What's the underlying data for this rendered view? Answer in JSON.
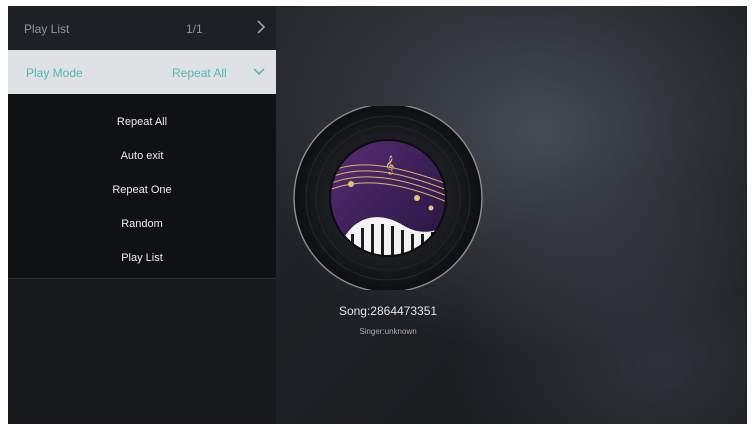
{
  "playlist_row": {
    "label": "Play List",
    "value": "1/1",
    "chevron_icon": "chevron-right-icon"
  },
  "playmode_row": {
    "label": "Play Mode",
    "value": "Repeat All",
    "chevron_icon": "chevron-down-icon"
  },
  "playmode_options": [
    "Repeat All",
    "Auto exit",
    "Repeat One",
    "Random",
    "Play List"
  ],
  "now_playing": {
    "song": "Song:2864473351",
    "singer": "Singer:unknown"
  },
  "colors": {
    "accent": "#58b6b0",
    "selected_row_bg": "#dfe2e5",
    "panel_bg": "#17191c"
  }
}
